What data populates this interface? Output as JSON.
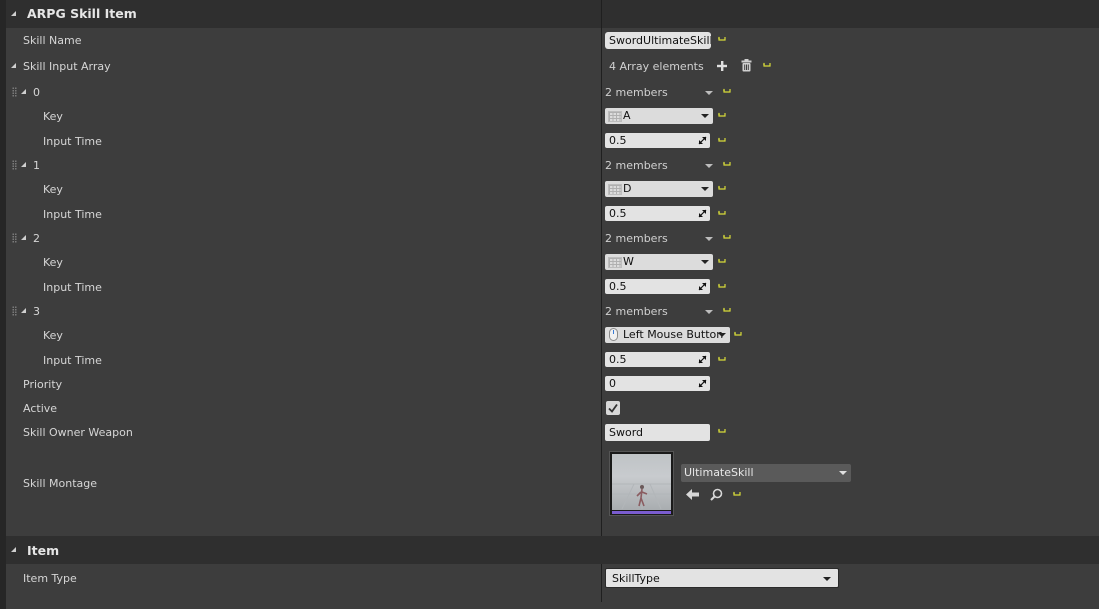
{
  "categories": {
    "arpg": {
      "title": "ARPG Skill Item"
    },
    "item": {
      "title": "Item"
    }
  },
  "labels": {
    "skill_name": "Skill Name",
    "skill_input_array": "Skill Input Array",
    "key": "Key",
    "input_time": "Input Time",
    "priority": "Priority",
    "active": "Active",
    "skill_owner_weapon": "Skill Owner Weapon",
    "skill_montage": "Skill Montage",
    "item_type": "Item Type"
  },
  "values": {
    "skill_name": "SwordUltimateSkill",
    "array_count": "4 Array elements",
    "priority": "0",
    "active": true,
    "skill_owner_weapon": "Sword",
    "montage_asset": "UltimateSkill",
    "item_type": "SkillType"
  },
  "elements": [
    {
      "index": "0",
      "members": "2 members",
      "key": "A",
      "key_icon": "keyboard-icon",
      "input_time": "0.5"
    },
    {
      "index": "1",
      "members": "2 members",
      "key": "D",
      "key_icon": "keyboard-icon",
      "input_time": "0.5"
    },
    {
      "index": "2",
      "members": "2 members",
      "key": "W",
      "key_icon": "keyboard-icon",
      "input_time": "0.5"
    },
    {
      "index": "3",
      "members": "2 members",
      "key": "Left Mouse Button",
      "key_icon": "mouse-icon",
      "input_time": "0.5"
    }
  ],
  "icons": {
    "add": "plus-icon",
    "clear": "trash-icon",
    "reset": "reset-to-default-icon",
    "browse": "use-selected-arrow-icon",
    "find": "search-icon"
  },
  "colors": {
    "background": "#3d3d3d",
    "category_bar": "#2f2f2f",
    "reset_arrow": "#d8dc3a",
    "field": "#e3e3e3"
  }
}
